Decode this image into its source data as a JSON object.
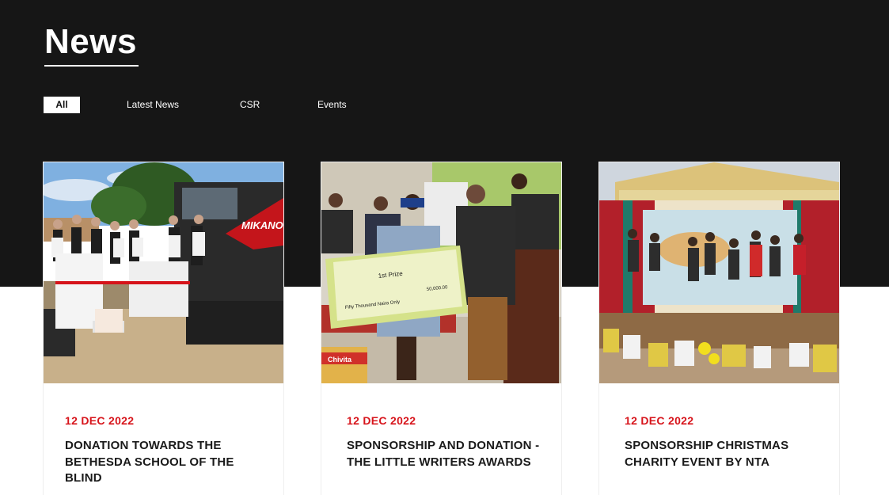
{
  "page": {
    "title": "News"
  },
  "filters": [
    {
      "label": "All",
      "active": true
    },
    {
      "label": "Latest News",
      "active": false
    },
    {
      "label": "CSR",
      "active": false
    },
    {
      "label": "Events",
      "active": false
    }
  ],
  "cards": [
    {
      "date": "12 DEC 2022",
      "title": "DONATION TOWARDS THE BETHESDA SCHOOL OF THE BLIND",
      "image": {
        "banner_text": "MIKANO"
      }
    },
    {
      "date": "12 DEC 2022",
      "title": "SPONSORSHIP AND DONATION - THE LITTLE WRITERS AWARDS",
      "image": {
        "cheque_prize": "1st Prize",
        "cheque_amount": "50,000.00",
        "cheque_words": "Fifty Thousand Naira Only",
        "box_text": "Chivita"
      }
    },
    {
      "date": "12 DEC 2022",
      "title": "SPONSORSHIP CHRISTMAS CHARITY EVENT BY NTA",
      "image": {}
    }
  ],
  "colors": {
    "hero_bg": "#161616",
    "accent": "#d7141b",
    "text": "#1a1a1a"
  }
}
